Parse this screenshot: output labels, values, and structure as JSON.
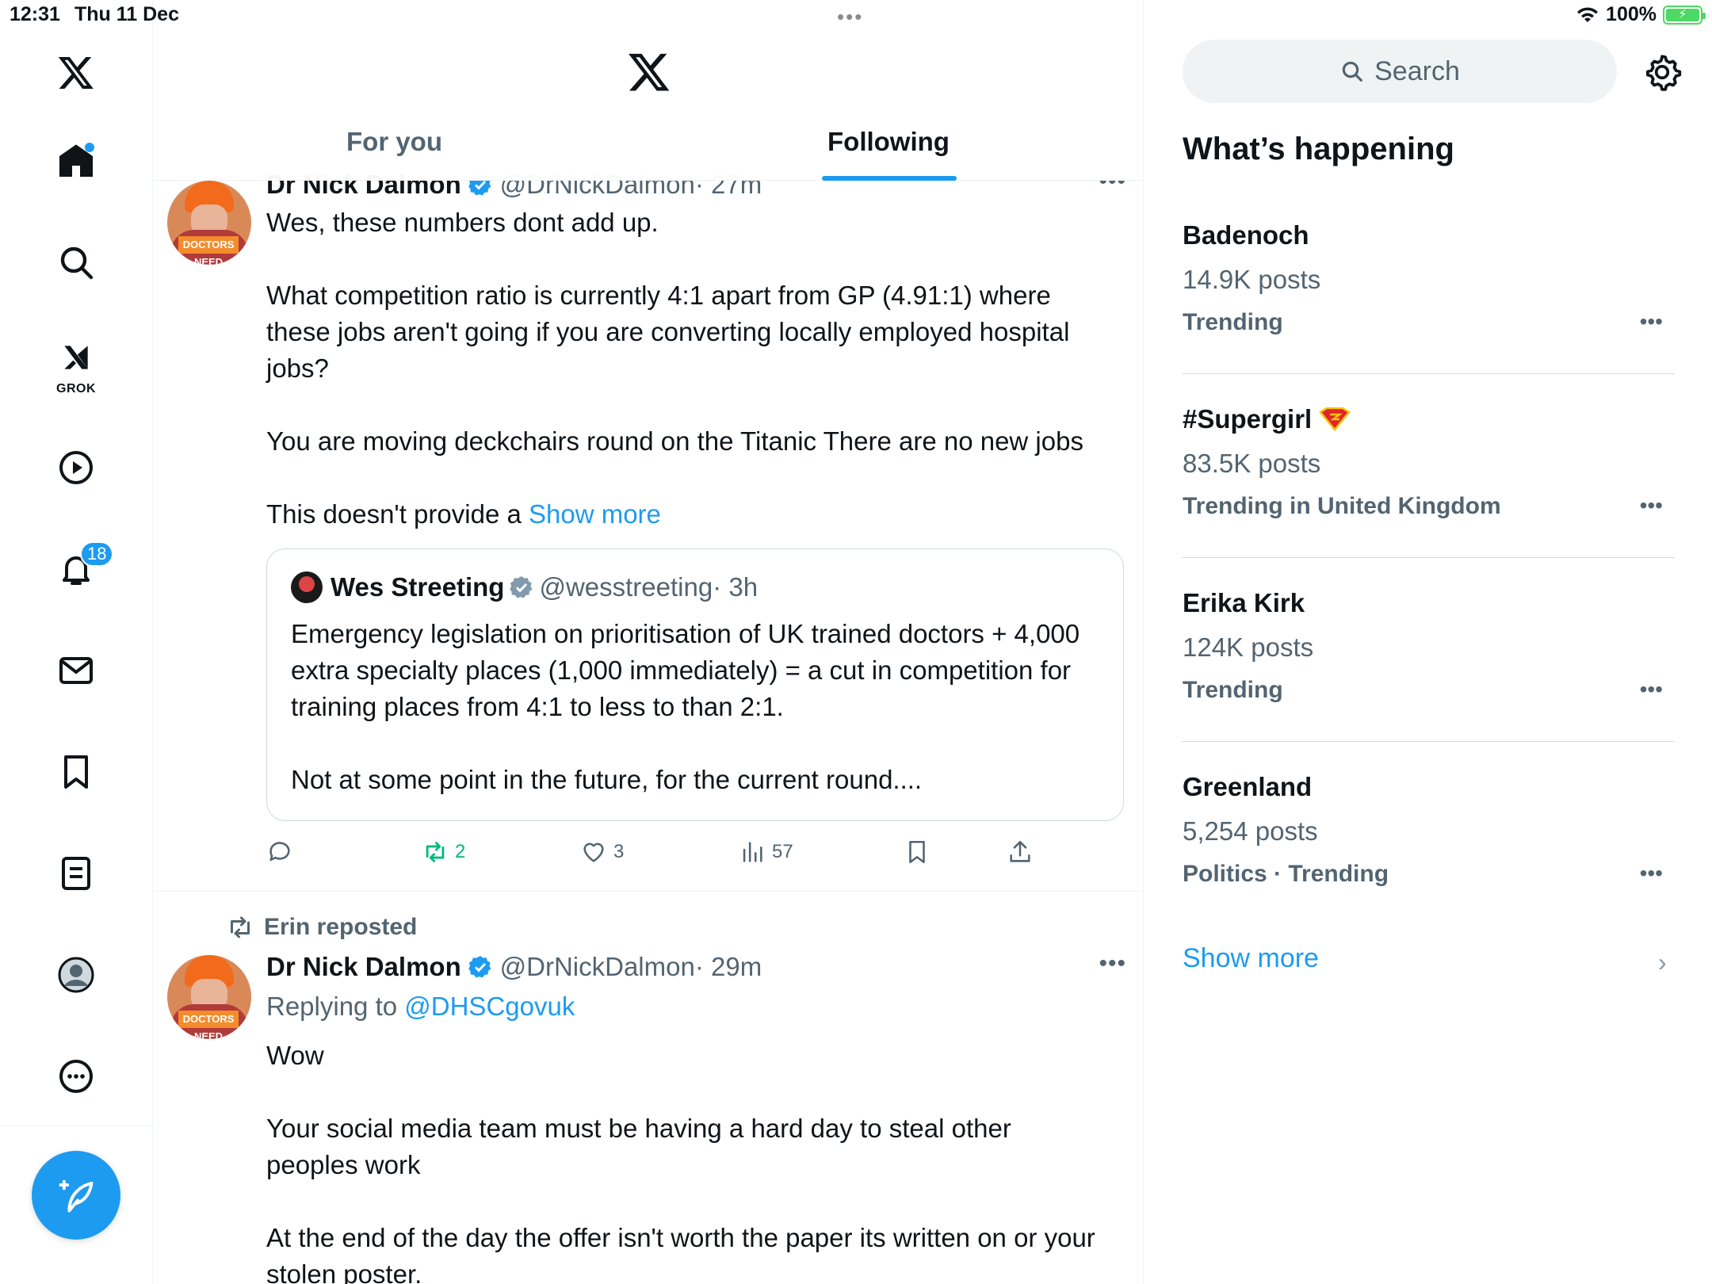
{
  "status": {
    "time": "12:31",
    "date": "Thu 11 Dec",
    "battery": "100%",
    "battery_level": 1.0
  },
  "nav": {
    "items": [
      {
        "name": "x-logo"
      },
      {
        "name": "home"
      },
      {
        "name": "search"
      },
      {
        "name": "grok",
        "label": "GROK"
      },
      {
        "name": "video"
      },
      {
        "name": "notifications",
        "badge": "18"
      },
      {
        "name": "messages"
      },
      {
        "name": "bookmarks"
      },
      {
        "name": "lists"
      },
      {
        "name": "profile"
      },
      {
        "name": "more"
      }
    ]
  },
  "main": {
    "tabs": [
      {
        "label": "For you",
        "active": false
      },
      {
        "label": "Following",
        "active": true
      }
    ]
  },
  "tweets": [
    {
      "name": "Dr Nick Dalmon",
      "handle": "@DrNickDalmon",
      "time": "· 27m",
      "avatar_sign": "DOCTORS NEED",
      "text": [
        "Wes, these numbers dont add up.",
        "What competition ratio is currently 4:1 apart from GP (4.91:1) where these jobs aren't going if you are converting locally employed hospital jobs?",
        "You are moving deckchairs round on the Titanic  There are no new jobs"
      ],
      "truncated_text": "This doesn't provide a ",
      "show_more": "Show more",
      "quote": {
        "name": "Wes Streeting",
        "handle": "@wesstreeting",
        "time": "· 3h",
        "text": [
          "Emergency legislation on prioritisation of UK trained doctors + 4,000 extra specialty places (1,000 immediately) = a cut in competition for training places from 4:1 to less to than 2:1.",
          "Not at some point in the future, for the current round...."
        ]
      },
      "actions": {
        "reposts": "2",
        "likes": "3",
        "views": "57"
      }
    },
    {
      "repost_by": "Erin reposted",
      "name": "Dr Nick Dalmon",
      "handle": "@DrNickDalmon",
      "time": "· 29m",
      "avatar_sign": "DOCTORS NEED",
      "reply_prefix": "Replying to ",
      "reply_to": "@DHSCgovuk",
      "text": [
        "Wow",
        "Your social media team must be having a hard day to steal other peoples work",
        "At the end of the day the offer isn't worth the paper its written on or your stolen poster."
      ]
    }
  ],
  "sidebar": {
    "search_placeholder": "Search",
    "title": "What’s happening",
    "trends": [
      {
        "name": "Badenoch",
        "posts": "14.9K posts",
        "context": "Trending"
      },
      {
        "name": "#Supergirl",
        "posts": "83.5K posts",
        "context": "Trending in United Kingdom"
      },
      {
        "name": "Erika Kirk",
        "posts": "124K posts",
        "context": "Trending"
      },
      {
        "name": "Greenland",
        "posts": "5,254 posts",
        "context": "Politics · Trending"
      }
    ],
    "show_more": "Show more"
  },
  "colors": {
    "accent": "#1d9bf0",
    "retweet": "#00ba7c",
    "text_secondary": "#536471"
  }
}
